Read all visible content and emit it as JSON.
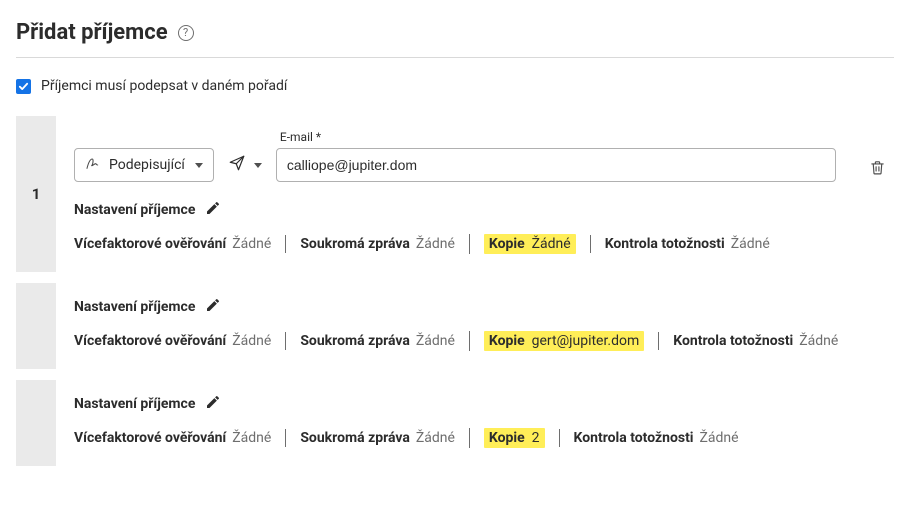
{
  "header": {
    "title": "Přidat příjemce"
  },
  "options": {
    "sign_in_order_label": "Příjemci musí podepsat v daném pořadí",
    "sign_in_order_checked": true
  },
  "labels": {
    "email": "E-mail",
    "required_mark": "*",
    "settings": "Nastavení příjemce",
    "mfa": "Vícefaktorové ověřování",
    "private_msg": "Soukromá zpráva",
    "copy": "Kopie",
    "id_check": "Kontrola totožnosti",
    "none": "Žádné"
  },
  "role": {
    "label": "Podepisující"
  },
  "recipients": [
    {
      "order": "1",
      "email": "calliope@jupiter.dom",
      "mfa": "Žádné",
      "private_msg": "Žádné",
      "copy": "Žádné",
      "id_check": "Žádné"
    },
    {
      "mfa": "Žádné",
      "private_msg": "Žádné",
      "copy": "gert@jupiter.dom",
      "id_check": "Žádné"
    },
    {
      "mfa": "Žádné",
      "private_msg": "Žádné",
      "copy": "2",
      "id_check": "Žádné"
    }
  ]
}
